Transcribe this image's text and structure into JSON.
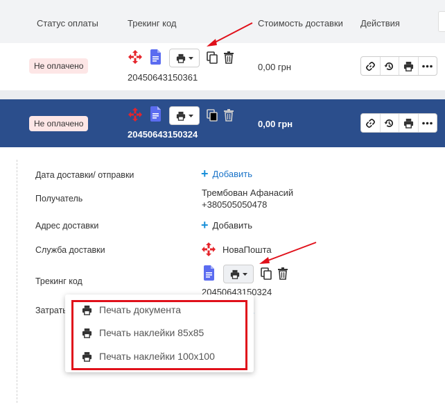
{
  "table": {
    "headers": {
      "payment_status": "Статус оплаты",
      "tracking": "Трекинг код",
      "delivery_cost": "Стоимость доставки",
      "actions": "Действия"
    },
    "rows": [
      {
        "payment_status": "Не оплачено",
        "tracking_code": "20450643150361",
        "delivery_cost": "0,00 грн"
      },
      {
        "payment_status": "Не оплачено",
        "tracking_code": "20450643150324",
        "delivery_cost": "0,00 грн"
      }
    ]
  },
  "details": {
    "delivery_date_label": "Дата доставки/ отправки",
    "delivery_date_action": "Добавить",
    "recipient_label": "Получатель",
    "recipient_name": "Трембован Афанасий",
    "recipient_phone": "+380505050478",
    "address_label": "Адрес доставки",
    "address_action": "Добавить",
    "service_label": "Служба доставки",
    "service_name": "НоваПошта",
    "tracking_label": "Трекинг код",
    "tracking_code": "20450643150324",
    "expenses_label": "Затраты",
    "expenses_partial": "ь"
  },
  "print_menu": {
    "items": [
      "Печать документа",
      "Печать наклейки 85x85",
      "Печать наклейки 100x100"
    ]
  },
  "colors": {
    "selected_row": "#2b4e8c",
    "badge_bg": "#fde6e6",
    "accent_link": "#1a73c8",
    "annotation": "#e0101a",
    "novaposhta": "#e5242b",
    "doc_icon": "#5b6cf0"
  },
  "icons": [
    "novaposhta-logo-icon",
    "document-icon",
    "printer-icon",
    "caret-down-icon",
    "copy-icon",
    "trash-icon",
    "link-icon",
    "history-icon",
    "more-icon",
    "plus-icon"
  ]
}
